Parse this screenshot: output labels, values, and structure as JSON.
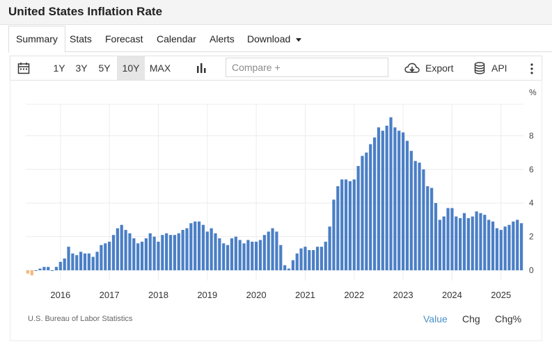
{
  "page": {
    "title": "United States Inflation Rate"
  },
  "tabs": [
    {
      "label": "Summary",
      "active": true
    },
    {
      "label": "Stats"
    },
    {
      "label": "Forecast"
    },
    {
      "label": "Calendar"
    },
    {
      "label": "Alerts"
    },
    {
      "label": "Download"
    }
  ],
  "toolbar": {
    "ranges": [
      "1Y",
      "3Y",
      "5Y",
      "10Y",
      "MAX"
    ],
    "active_range": "10Y",
    "compare_placeholder": "Compare +",
    "export_label": "Export",
    "api_label": "API",
    "icons": [
      "calendar-icon",
      "bar-chart-icon",
      "cloud-download-icon",
      "database-icon",
      "more-vertical-icon"
    ]
  },
  "chart_unit": "%",
  "source": "U.S. Bureau of Labor Statistics",
  "view_modes": [
    "Value",
    "Chg",
    "Chg%"
  ],
  "active_mode": "Value",
  "colors": {
    "bar": "#4b7fc6",
    "bar_negative": "#f5b97a",
    "grid": "#ececec",
    "active_link": "#4a90c8"
  },
  "chart_data": {
    "type": "bar",
    "title": "",
    "xlabel": "",
    "ylabel": "",
    "x_start": "2015-04",
    "x_ticks": [
      "2016",
      "2017",
      "2018",
      "2019",
      "2020",
      "2021",
      "2022",
      "2023",
      "2024",
      "2025"
    ],
    "y_ticks": [
      0,
      2,
      4,
      6,
      8
    ],
    "ylim": [
      -0.6,
      9.9
    ],
    "y_axis_position": "right",
    "grid": true,
    "values": [
      -0.2,
      -0.3,
      0.0,
      0.1,
      0.2,
      0.2,
      0.0,
      0.2,
      0.5,
      0.7,
      1.4,
      1.0,
      0.9,
      1.1,
      1.0,
      1.0,
      0.8,
      1.1,
      1.5,
      1.6,
      1.7,
      2.1,
      2.5,
      2.7,
      2.4,
      2.2,
      1.9,
      1.6,
      1.7,
      1.9,
      2.2,
      2.0,
      1.7,
      2.1,
      2.2,
      2.1,
      2.1,
      2.2,
      2.4,
      2.5,
      2.8,
      2.9,
      2.9,
      2.7,
      2.3,
      2.5,
      2.2,
      1.9,
      1.6,
      1.5,
      1.9,
      2.0,
      1.8,
      1.6,
      1.8,
      1.7,
      1.7,
      1.8,
      2.1,
      2.3,
      2.5,
      2.3,
      1.5,
      0.3,
      0.1,
      0.6,
      1.0,
      1.3,
      1.4,
      1.2,
      1.2,
      1.4,
      1.4,
      1.7,
      2.6,
      4.2,
      5.0,
      5.4,
      5.4,
      5.3,
      5.4,
      6.2,
      6.8,
      7.0,
      7.5,
      7.9,
      8.5,
      8.3,
      8.6,
      9.1,
      8.5,
      8.3,
      8.2,
      7.7,
      7.1,
      6.5,
      6.4,
      6.0,
      5.0,
      4.9,
      4.0,
      3.0,
      3.2,
      3.7,
      3.7,
      3.2,
      3.1,
      3.4,
      3.1,
      3.2,
      3.5,
      3.4,
      3.3,
      3.0,
      2.9,
      2.5,
      2.4,
      2.6,
      2.7,
      2.9,
      3.0,
      2.8
    ],
    "value_note": "monthly year-over-year CPI inflation, Apr 2015 to Feb 2025"
  }
}
